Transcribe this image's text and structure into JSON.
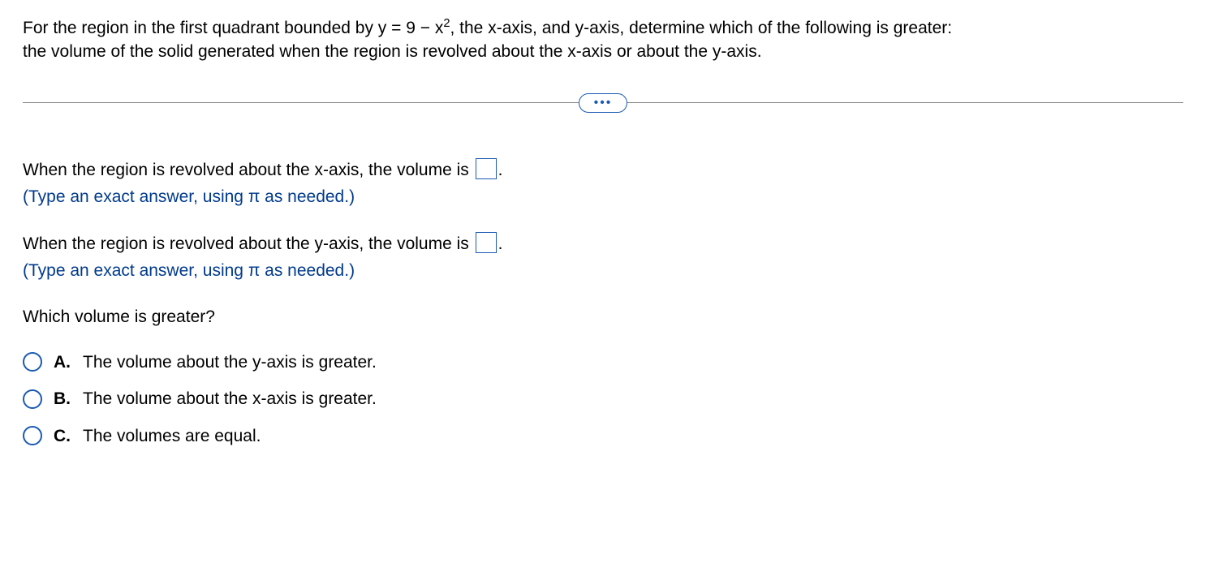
{
  "question": {
    "line1_pre": "For the region in the first quadrant bounded by y = 9 − x",
    "line1_sup": "2",
    "line1_post": ", the x-axis, and y-axis, determine which of the following is greater:",
    "line2": "the volume of the solid generated when the region is revolved about the x-axis or about the y-axis."
  },
  "part1": {
    "text_pre": "When the region is revolved about the x-axis, the volume is ",
    "text_post": ".",
    "hint": "(Type an exact answer, using π as needed.)"
  },
  "part2": {
    "text_pre": "When the region is revolved about the y-axis, the volume is ",
    "text_post": ".",
    "hint": "(Type an exact answer, using π as needed.)"
  },
  "which_question": "Which volume is greater?",
  "choices": [
    {
      "letter": "A.",
      "text": "The volume about the y-axis is greater."
    },
    {
      "letter": "B.",
      "text": "The volume about the x-axis is greater."
    },
    {
      "letter": "C.",
      "text": "The volumes are equal."
    }
  ]
}
